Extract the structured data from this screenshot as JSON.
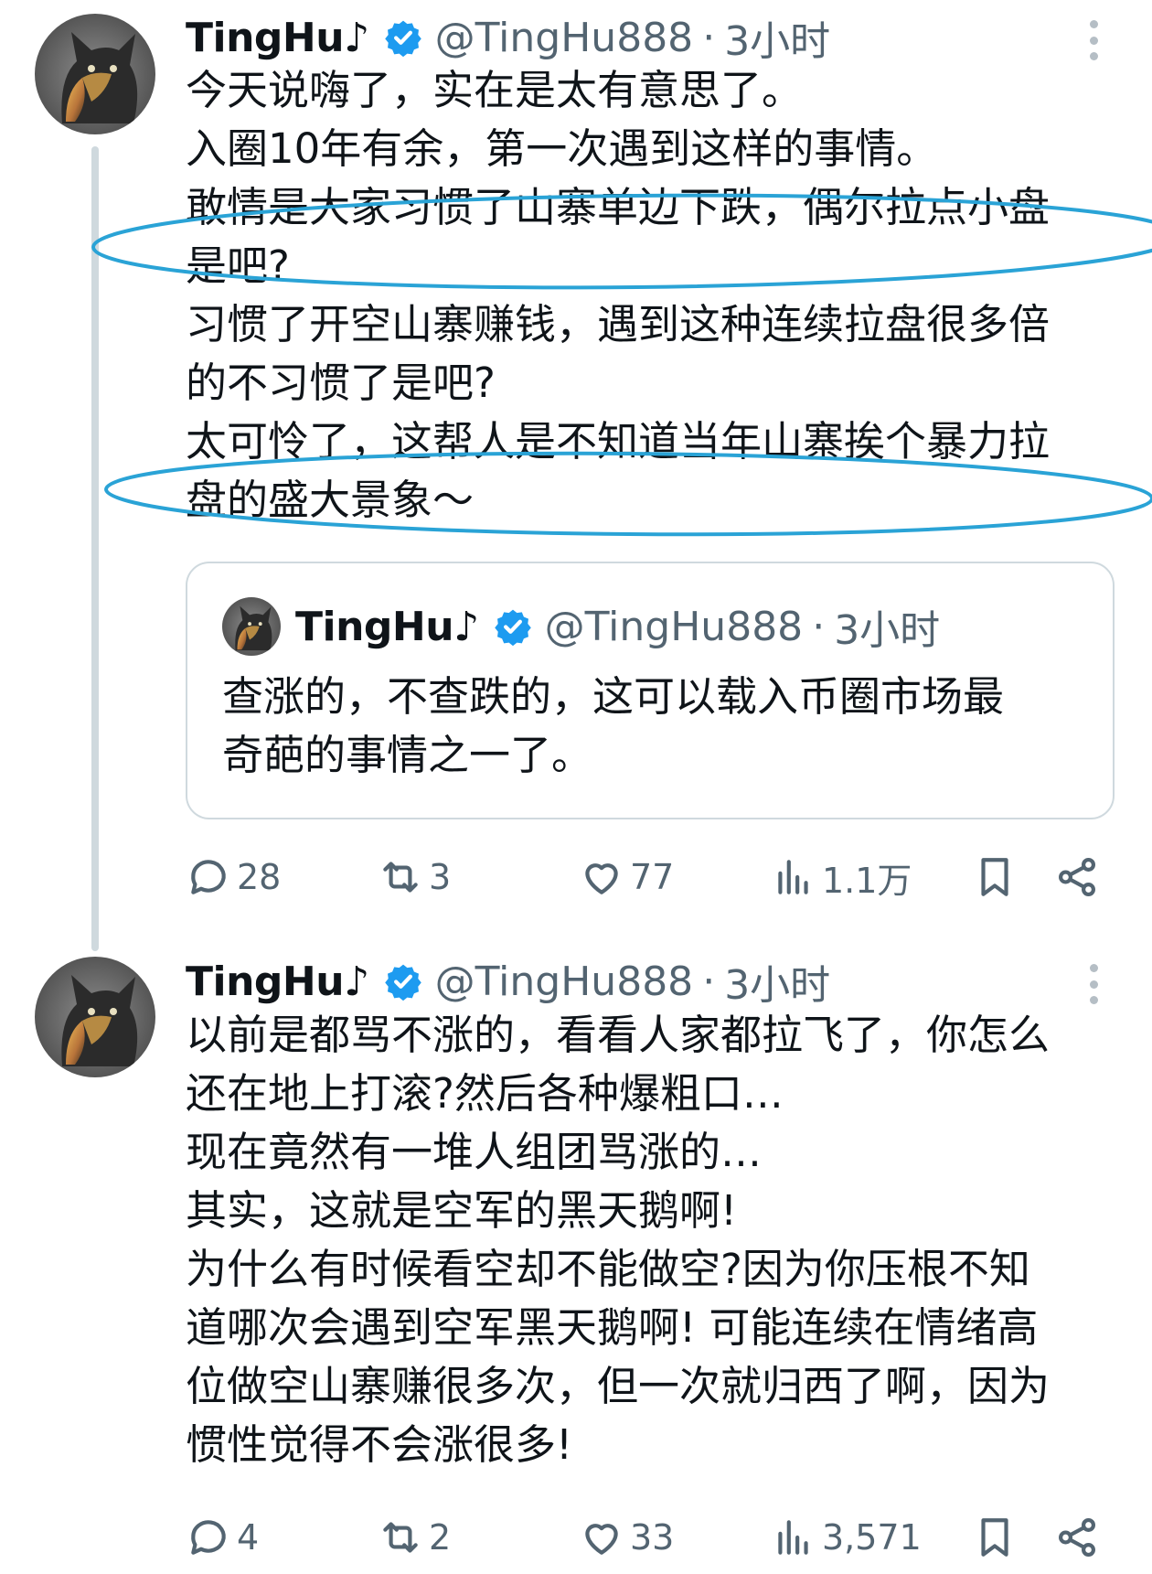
{
  "tweets": [
    {
      "name": "TingHu♪",
      "handle": "@TingHu888",
      "dot": "·",
      "time": "3小时",
      "text": "今天说嗨了，实在是太有意思了。\n入圈10年有余，第一次遇到这样的事情。\n敢情是大家习惯了山寨单边下跌，偶尔拉点小盘\n是吧?\n习惯了开空山寨赚钱，遇到这种连续拉盘很多倍\n的不习惯了是吧?\n太可怜了，这帮人是不知道当年山寨挨个暴力拉\n盘的盛大景象～",
      "quote": {
        "name": "TingHu♪",
        "handle": "@TingHu888",
        "dot": "·",
        "time": "3小时",
        "text": "查涨的，不查跌的，这可以载入币圈市场最\n奇葩的事情之一了。"
      },
      "replies": "28",
      "reposts": "3",
      "likes": "77",
      "views": "1.1万"
    },
    {
      "name": "TingHu♪",
      "handle": "@TingHu888",
      "dot": "·",
      "time": "3小时",
      "text": "以前是都骂不涨的，看看人家都拉飞了，你怎么\n还在地上打滚?然后各种爆粗口…\n现在竟然有一堆人组团骂涨的…\n其实，这就是空军的黑天鹅啊!\n为什么有时候看空却不能做空?因为你压根不知\n道哪次会遇到空军黑天鹅啊! 可能连续在情绪高\n位做空山寨赚很多次，但一次就归西了啊，因为\n惯性觉得不会涨很多!",
      "replies": "4",
      "reposts": "2",
      "likes": "33",
      "views": "3,571"
    }
  ],
  "colors": {
    "text": "#0f1419",
    "secondary": "#536471",
    "verified": "#1d9bf0",
    "annotation": "#2aa3d6",
    "border": "#cfd9de"
  }
}
